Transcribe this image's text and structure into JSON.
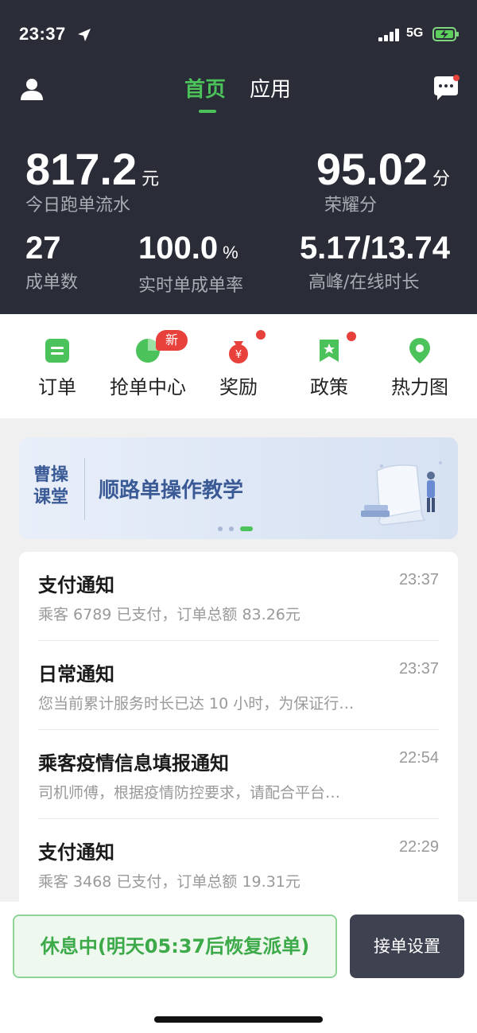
{
  "status_bar": {
    "time": "23:37",
    "network": "5G"
  },
  "tabs": {
    "home": "首页",
    "apps": "应用"
  },
  "stats": {
    "earnings_value": "817.2",
    "earnings_unit": "元",
    "earnings_label": "今日跑单流水",
    "honor_value": "95.02",
    "honor_unit": "分",
    "honor_label": "荣耀分",
    "orders_value": "27",
    "orders_label": "成单数",
    "rate_value": "100.0",
    "rate_unit": "%",
    "rate_label": "实时单成单率",
    "hours_value": "5.17/13.74",
    "hours_label": "高峰/在线时长"
  },
  "quick_menu": [
    {
      "label": "订单",
      "icon": "order-icon"
    },
    {
      "label": "抢单中心",
      "icon": "grab-order-icon",
      "badge": "新"
    },
    {
      "label": "奖励",
      "icon": "reward-icon"
    },
    {
      "label": "政策",
      "icon": "policy-icon"
    },
    {
      "label": "热力图",
      "icon": "heatmap-icon"
    }
  ],
  "banner": {
    "tag": "曹操课堂",
    "title": "顺路单操作教学"
  },
  "notifications": [
    {
      "title": "支付通知",
      "time": "23:37",
      "body": "乘客 6789 已支付，订单总额 83.26元"
    },
    {
      "title": "日常通知",
      "time": "23:37",
      "body": "您当前累计服务时长已达 10 小时，为保证行…"
    },
    {
      "title": "乘客疫情信息填报通知",
      "time": "22:54",
      "body": "司机师傅，根据疫情防控要求，请配合平台…"
    },
    {
      "title": "支付通知",
      "time": "22:29",
      "body": "乘客 3468 已支付，订单总额 19.31元"
    }
  ],
  "bottom": {
    "rest_status": "休息中(明天05:37后恢复派单)",
    "settings_label": "接单设置"
  },
  "colors": {
    "accent": "#4cc35a",
    "header_bg": "#2a2d37",
    "badge_red": "#e8413c",
    "banner_text": "#3a5a96"
  }
}
